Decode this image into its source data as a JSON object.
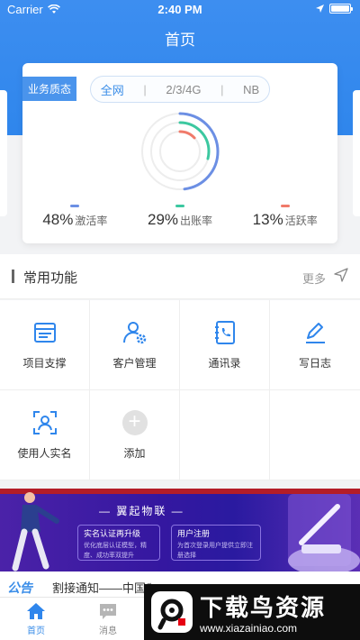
{
  "status_bar": {
    "carrier": "Carrier",
    "time": "2:40 PM",
    "battery_level": 1.0
  },
  "header": {
    "title": "首页"
  },
  "quality_card": {
    "tag": "业务质态",
    "segments": [
      "全网",
      "2/3/4G",
      "NB"
    ],
    "separators": [
      "|",
      "|"
    ],
    "active_segment": "全网",
    "stats": [
      {
        "value": "48%",
        "label": "激活率",
        "color": "#6c8fe4"
      },
      {
        "value": "29%",
        "label": "出账率",
        "color": "#3cc8a0"
      },
      {
        "value": "13%",
        "label": "活跃率",
        "color": "#f07a6a"
      }
    ]
  },
  "functions": {
    "title": "常用功能",
    "more": "更多",
    "items": [
      {
        "label": "项目支撑",
        "icon": "window-icon"
      },
      {
        "label": "客户管理",
        "icon": "user-gear-icon"
      },
      {
        "label": "通讯录",
        "icon": "phone-book-icon"
      },
      {
        "label": "写日志",
        "icon": "pen-icon"
      },
      {
        "label": "使用人实名",
        "icon": "face-scan-icon"
      },
      {
        "label": "添加",
        "icon": "plus-icon"
      }
    ]
  },
  "banner": {
    "headline": "— 翼起物联 —",
    "box1": {
      "title": "实名认证再升级",
      "body": "优化底层认证模型，精度、成功率双提升"
    },
    "box2": {
      "title": "用户注册",
      "body": "为首次登录用户提供立即注册选择"
    }
  },
  "notice": {
    "tag": "公告",
    "text": "割接通知——中国电信"
  },
  "tabs": [
    {
      "label": "首页",
      "icon": "home-icon",
      "active": true
    },
    {
      "label": "消息",
      "icon": "message-icon",
      "active": false
    }
  ],
  "watermark": {
    "title": "下载鸟资源",
    "url": "www.xiazainiao.com"
  },
  "colors": {
    "primary": "#3a8de8",
    "header": "#3d8ef0"
  }
}
